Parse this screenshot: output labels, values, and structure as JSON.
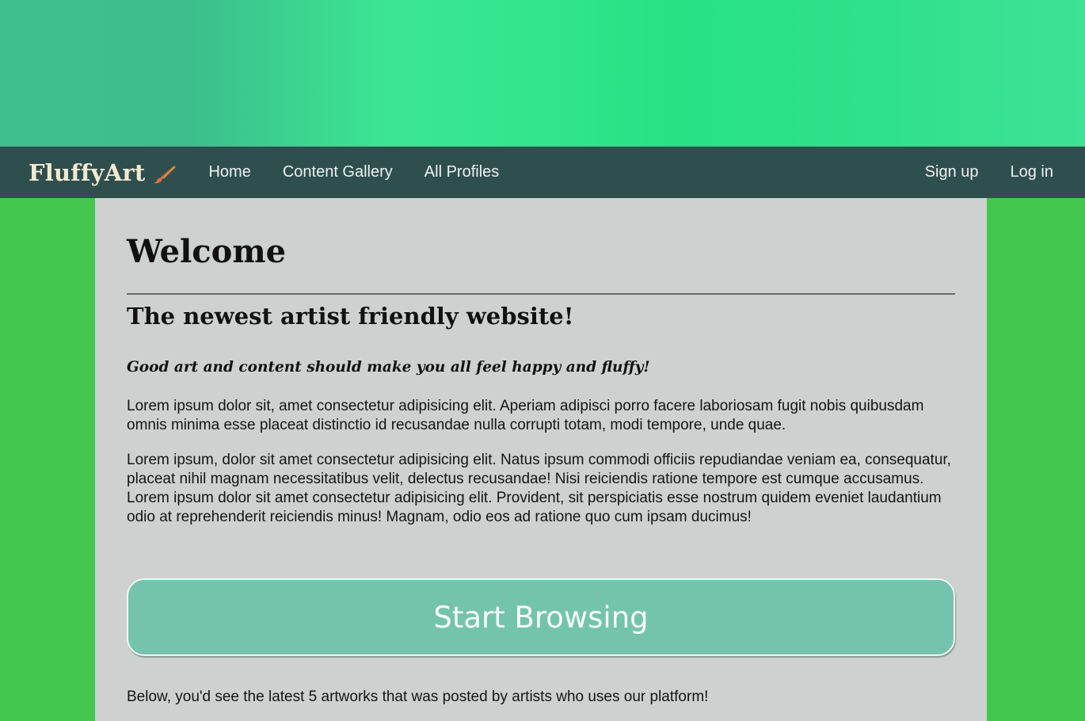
{
  "nav": {
    "brand": "FluffyArt",
    "brand_icon": "paintbrush-icon",
    "links": [
      "Home",
      "Content Gallery",
      "All Profiles"
    ],
    "right_links": [
      "Sign up",
      "Log in"
    ]
  },
  "main": {
    "heading": "Welcome",
    "subtitle": "The newest artist friendly website!",
    "tagline": "Good art and content should make you all feel happy and fluffy!",
    "paragraph1": "Lorem ipsum dolor sit, amet consectetur adipisicing elit. Aperiam adipisci porro facere laboriosam fugit nobis quibusdam omnis minima esse placeat distinctio id recusandae nulla corrupti totam, modi tempore, unde quae.",
    "paragraph2": "Lorem ipsum, dolor sit amet consectetur adipisicing elit. Natus ipsum commodi officiis repudiandae veniam ea, consequatur, placeat nihil magnam necessitatibus velit, delectus recusandae! Nisi reiciendis ratione tempore est cumque accusamus. Lorem ipsum dolor sit amet consectetur adipisicing elit. Provident, sit perspiciatis esse nostrum quidem eveniet laudantium odio at reprehenderit reiciendis minus! Magnam, odio eos ad ratione quo cum ipsam ducimus!",
    "cta_label": "Start Browsing",
    "below_text": "Below, you'd see the latest 5 artworks that was posted by artists who uses our platform!"
  },
  "colors": {
    "page_background": "#43c74f",
    "navbar": "#2f4f4f",
    "content_panel": "#cdd1d0",
    "cta_button": "#74c4ad",
    "brand_text": "#f3ead2",
    "brush_icon": "#d9733a"
  }
}
